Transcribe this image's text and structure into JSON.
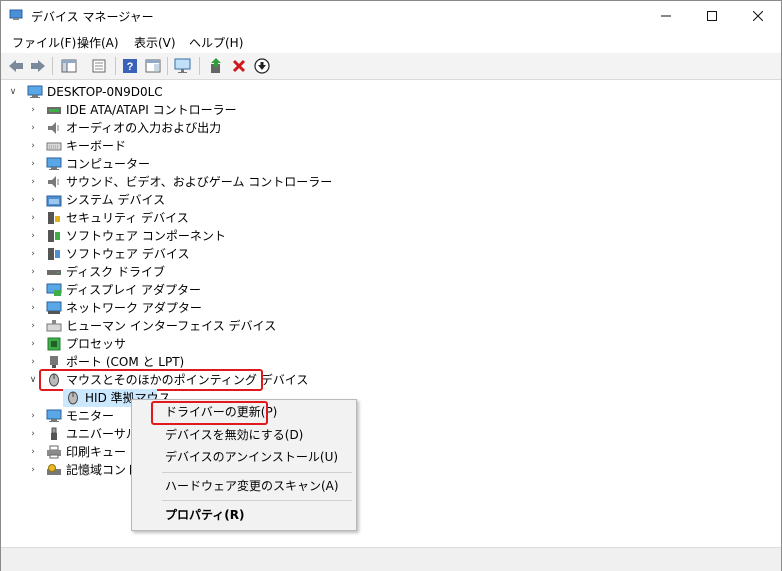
{
  "window": {
    "title": "デバイス マネージャー"
  },
  "menu": [
    "ファイル(F)",
    "操作(A)",
    "表示(V)",
    "ヘルプ(H)"
  ],
  "tree": {
    "root": "DESKTOP-0N9D0LC",
    "items": [
      {
        "label": "IDE ATA/ATAPI コントローラー",
        "icon": "ide-controller-icon"
      },
      {
        "label": "オーディオの入力および出力",
        "icon": "speaker-icon"
      },
      {
        "label": "キーボード",
        "icon": "keyboard-icon"
      },
      {
        "label": "コンピューター",
        "icon": "monitor-icon"
      },
      {
        "label": "サウンド、ビデオ、およびゲーム コントローラー",
        "icon": "speaker-icon"
      },
      {
        "label": "システム デバイス",
        "icon": "folder-device-icon"
      },
      {
        "label": "セキュリティ デバイス",
        "icon": "security-device-icon"
      },
      {
        "label": "ソフトウェア コンポーネント",
        "icon": "software-component-icon"
      },
      {
        "label": "ソフトウェア デバイス",
        "icon": "software-device-icon"
      },
      {
        "label": "ディスク ドライブ",
        "icon": "disk-drive-icon"
      },
      {
        "label": "ディスプレイ アダプター",
        "icon": "display-adapter-icon"
      },
      {
        "label": "ネットワーク アダプター",
        "icon": "network-adapter-icon"
      },
      {
        "label": "ヒューマン インターフェイス デバイス",
        "icon": "hid-icon"
      },
      {
        "label": "プロセッサ",
        "icon": "processor-icon"
      },
      {
        "label": "ポート (COM と LPT)",
        "icon": "port-icon"
      },
      {
        "label": "マウスとそのほかのポインティング デバイス",
        "icon": "mouse-icon"
      },
      {
        "label": "HID 準拠マウス",
        "icon": "mouse-icon"
      },
      {
        "label": "モニター",
        "icon": "monitor-icon"
      },
      {
        "label": "ユニバーサル シ",
        "icon": "usb-icon"
      },
      {
        "label": "印刷キュー",
        "icon": "printer-icon"
      },
      {
        "label": "記憶域コントロ",
        "icon": "storage-controller-icon"
      }
    ]
  },
  "context_menu": {
    "items": [
      "ドライバーの更新(P)",
      "デバイスを無効にする(D)",
      "デバイスのアンインストール(U)",
      "ハードウェア変更のスキャン(A)",
      "プロパティ(R)"
    ]
  },
  "colors": {
    "highlight_border": "#e0191c",
    "selection_bg": "#cce8ff"
  }
}
